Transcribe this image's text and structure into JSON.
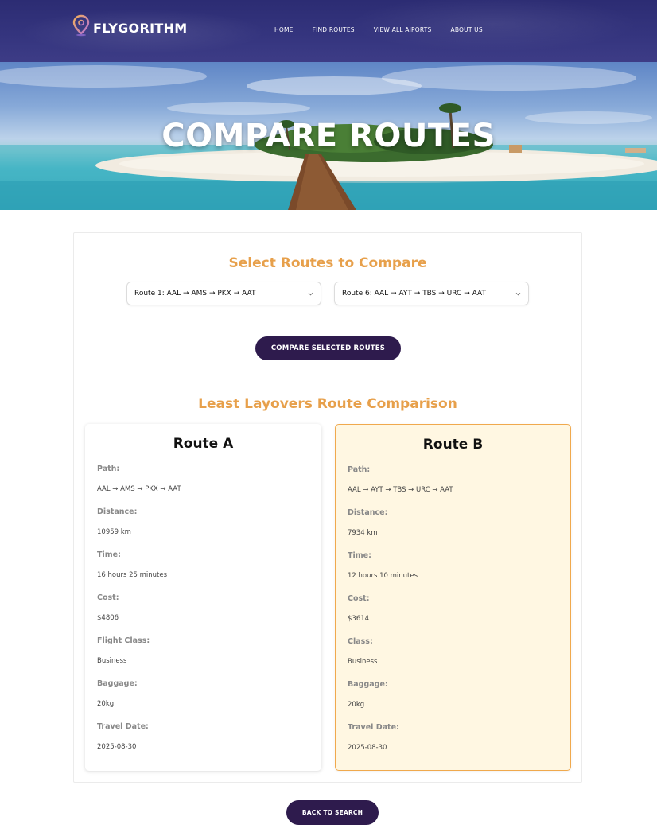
{
  "header": {
    "brand": "FLYGORITHM",
    "nav": [
      "HOME",
      "FIND ROUTES",
      "VIEW ALL AIPORTS",
      "ABOUT US"
    ]
  },
  "hero": {
    "title": "COMPARE ROUTES"
  },
  "compare": {
    "title": "Select Routes to Compare",
    "select_a": "Route 1: AAL → AMS → PKX → AAT",
    "select_b": "Route 6: AAL → AYT → TBS → URC → AAT",
    "button": "COMPARE SELECTED ROUTES"
  },
  "results": {
    "title": "Least Layovers Route Comparison",
    "route_a": {
      "heading": "Route A",
      "fields": [
        {
          "label": "Path:",
          "value": "AAL → AMS → PKX → AAT"
        },
        {
          "label": "Distance:",
          "value": "10959 km"
        },
        {
          "label": "Time:",
          "value": "16 hours 25 minutes"
        },
        {
          "label": "Cost:",
          "value": "$4806"
        },
        {
          "label": "Flight Class:",
          "value": "Business"
        },
        {
          "label": "Baggage:",
          "value": "20kg"
        },
        {
          "label": "Travel Date:",
          "value": "2025-08-30"
        }
      ]
    },
    "route_b": {
      "heading": "Route B",
      "fields": [
        {
          "label": "Path:",
          "value": "AAL → AYT → TBS → URC → AAT"
        },
        {
          "label": "Distance:",
          "value": "7934 km"
        },
        {
          "label": "Time:",
          "value": "12 hours 10 minutes"
        },
        {
          "label": "Cost:",
          "value": "$3614"
        },
        {
          "label": "Class:",
          "value": "Business"
        },
        {
          "label": "Baggage:",
          "value": "20kg"
        },
        {
          "label": "Travel Date:",
          "value": "2025-08-30"
        }
      ]
    }
  },
  "footer": {
    "back_button": "BACK TO SEARCH"
  },
  "colors": {
    "nav_bg": "#2c2c73",
    "accent_orange": "#e7a04b",
    "button_dark": "#2e1b4d",
    "highlight_bg": "#fff7e2",
    "highlight_border": "#f0a94d"
  },
  "icons": {
    "logo": "map-pin-icon",
    "dropdown": "chevron-down-icon"
  }
}
